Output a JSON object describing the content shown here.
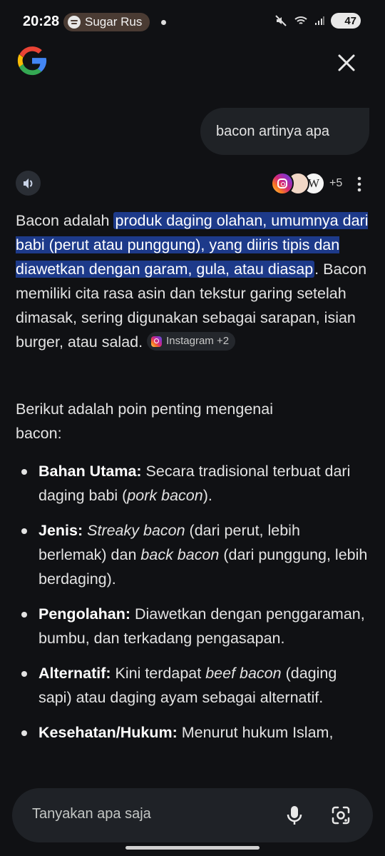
{
  "status_bar": {
    "time": "20:28",
    "media_label": "Sugar Rus",
    "battery": "47"
  },
  "chat": {
    "query": "bacon artinya apa",
    "sources_more": "+5",
    "answer": {
      "p1_lead": "Bacon adalah ",
      "p1_hl": "produk daging olahan, umumnya dari babi (perut atau punggung), yang diiris tipis dan diawetkan dengan garam, gula, atau diasap",
      "p1_rest": ". Bacon memiliki cita rasa asin dan tekstur garing setelah dimasak, sering digunakan sebagai sarapan, isian burger, atau salad.",
      "p1_chip": "Instagram +2",
      "intro": "Berikut adalah poin penting mengenai bacon:",
      "bullets": [
        {
          "label": "Bahan Utama:",
          "t1": " Secara tradisional terbuat dari daging babi (",
          "i1": "pork bacon",
          "t2": ")."
        },
        {
          "label": "Jenis:",
          "t0": " ",
          "i0": "Streaky bacon",
          "t1": " (dari perut, lebih berlemak) dan ",
          "i1": "back bacon",
          "t2": " (dari punggung, lebih berdaging)."
        },
        {
          "label": "Pengolahan:",
          "t1": " Diawetkan dengan penggaraman, bumbu, dan terkadang pengasapan."
        },
        {
          "label": "Alternatif:",
          "t1": " Kini terdapat ",
          "i1": "beef bacon",
          "t2": " (daging sapi) atau daging ayam sebagai alternatif."
        },
        {
          "label": "Kesehatan/Hukum:",
          "t1": " Menurut hukum Islam,"
        }
      ]
    }
  },
  "input": {
    "placeholder": "Tanyakan apa saja"
  },
  "icons": {
    "google_logo": "google-logo",
    "close": "close-icon",
    "speaker": "speaker-icon",
    "mic": "mic-icon",
    "lens": "lens-icon"
  }
}
